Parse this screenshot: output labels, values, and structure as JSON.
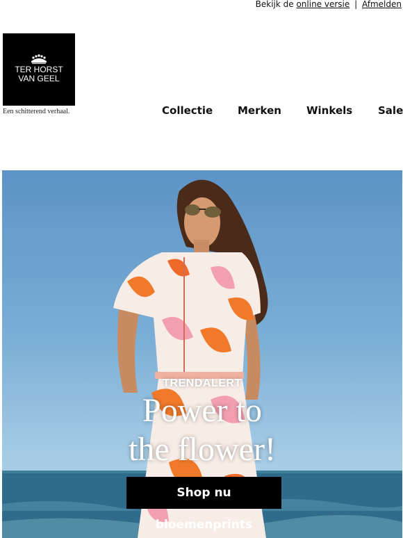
{
  "topbar": {
    "view_prefix": "Bekijk de",
    "online_version_link": "online versie",
    "separator": "|",
    "unsubscribe_link": "Afmelden"
  },
  "brand": {
    "logo_line1": "TER HORST",
    "logo_line2": "VAN GEEL",
    "tagline": "Een schitterend verhaal."
  },
  "nav": {
    "items": [
      "Collectie",
      "Merken",
      "Winkels",
      "Sale"
    ]
  },
  "hero": {
    "kicker": "TRENDALERT",
    "title_line1": "Power to",
    "title_line2": "the flower!",
    "cta_label": "Shop nu bloemenprints"
  },
  "colors": {
    "sky": "#6fa3d1",
    "sea": "#2f6b8a",
    "dress_orange": "#f07a2a",
    "dress_pink": "#f2a0b0",
    "button": "#000000"
  }
}
